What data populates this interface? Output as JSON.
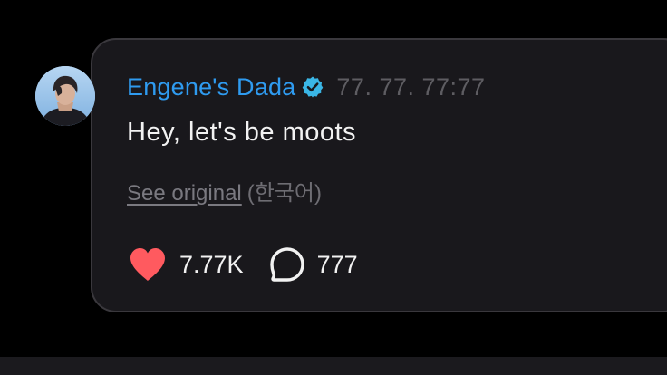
{
  "comment": {
    "username": "Engene's Dada",
    "verified": true,
    "timestamp": "77. 77. 77:77",
    "text": "Hey, let's be moots",
    "see_original_label": "See original",
    "language": "(한국어)",
    "likes_count": "7.77K",
    "replies_count": "777"
  },
  "colors": {
    "background": "#000000",
    "card": "#19181c",
    "card_border": "#3a383d",
    "username": "#2f9bf0",
    "verified_badge": "#3ab6e6",
    "heart": "#ff5a5f",
    "text": "#f2f2f2",
    "muted": "#6e6d73"
  },
  "icons": {
    "verified": "verified-badge-icon",
    "like": "heart-icon",
    "reply": "speech-bubble-icon"
  }
}
